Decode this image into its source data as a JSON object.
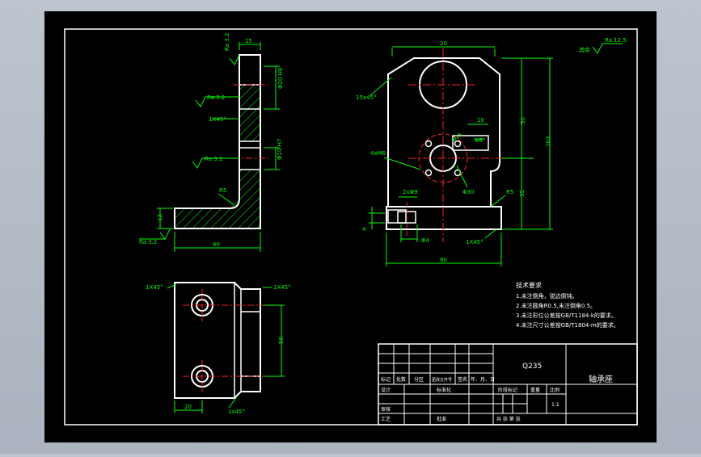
{
  "colors": {
    "background": "#000000",
    "outline": "#ffffff",
    "dimension": "#00ff00",
    "centerline": "#ff2020",
    "window_frame": "#b6bec9"
  },
  "dims": {
    "side_top_width": "15",
    "side_roughness_top": "Ra 3.2",
    "side_roughness_mid1": "Ra 3.2",
    "side_roughness_mid2": "Ra 3.2",
    "side_roughness_base": "Ra 3.2",
    "side_chamfer": "1X45°",
    "side_fillet": "R5",
    "side_base_height": "12",
    "side_total_width": "40",
    "side_dim_a": "Φ20 H8",
    "side_dim_b": "Φ10 H7",
    "front_top_width": "20",
    "front_chamfer": "15x45°",
    "front_holes": "4xM6",
    "front_dim_10": "10",
    "front_dim_50": "50",
    "front_dim_103": "103",
    "front_dim_35": "35",
    "front_dim_phi15": "Φ15",
    "front_dim_phi30": "Φ30",
    "front_dim_phi8": "Φ8",
    "front_dim_2x": "2xΦ9",
    "front_fillet": "R5",
    "front_base_chamfer": "1X45°",
    "front_base_width": "80",
    "front_small_1": "4",
    "front_small_2": "Φ4",
    "roughness_global_label": "其余",
    "roughness_global": "Ra 12.5",
    "top_chamfer_left": "1X45°",
    "top_chamfer_right": "1X45°",
    "top_dim_50": "50",
    "top_dim_20": "20",
    "top_bottom_chamfer": "1x45°"
  },
  "notes": {
    "title": "技术要求",
    "lines": [
      "1.未注倒角，锐边倒钝。",
      "2.未注圆角R0.5,未注倒角0.5。",
      "3.未注形位公差按GB/T1184-k的要求。",
      "4.未注尺寸公差按GB/T1804-m的要求。"
    ]
  },
  "title_block": {
    "material": "Q235",
    "part_name": "轴承座",
    "header": [
      "标记",
      "处数",
      "分区",
      "更改文件号",
      "签名",
      "年、月、日"
    ],
    "design": "设计",
    "standardization": "标准化",
    "review": "审核",
    "process": "工艺",
    "approve": "批准",
    "stage_mark": "阶段标记",
    "weight": "重量",
    "scale_label": "比例",
    "scale": "1:1",
    "sheets": "共  张  第  张"
  }
}
